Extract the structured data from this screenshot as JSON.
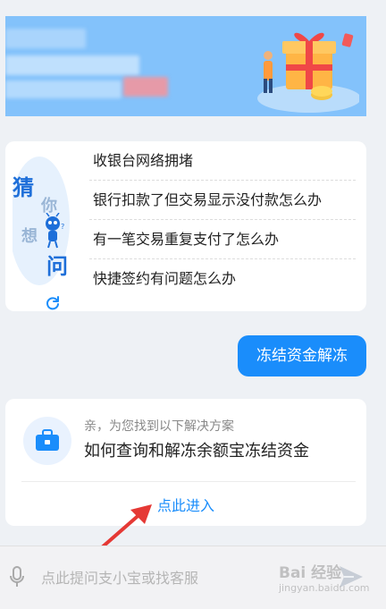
{
  "faq_card": {
    "guess_chars": [
      "猜",
      "你",
      "想",
      "问"
    ],
    "questions": [
      "收银台网络拥堵",
      "银行扣款了但交易显示没付款怎么办",
      "有一笔交易重复支付了怎么办",
      "快捷签约有问题怎么办"
    ]
  },
  "user_message": "冻结资金解冻",
  "solution": {
    "hint": "亲，为您找到以下解决方案",
    "title": "如何查询和解冻余额宝冻结资金",
    "link": "点此进入"
  },
  "input": {
    "placeholder": "点此提问支小宝或找客服"
  },
  "watermark": {
    "logo": "Bai 经验",
    "url": "jingyan.baidu.com"
  },
  "colors": {
    "accent": "#1a8dfb",
    "banner": "#83c2fb",
    "arrow": "#e53935"
  }
}
